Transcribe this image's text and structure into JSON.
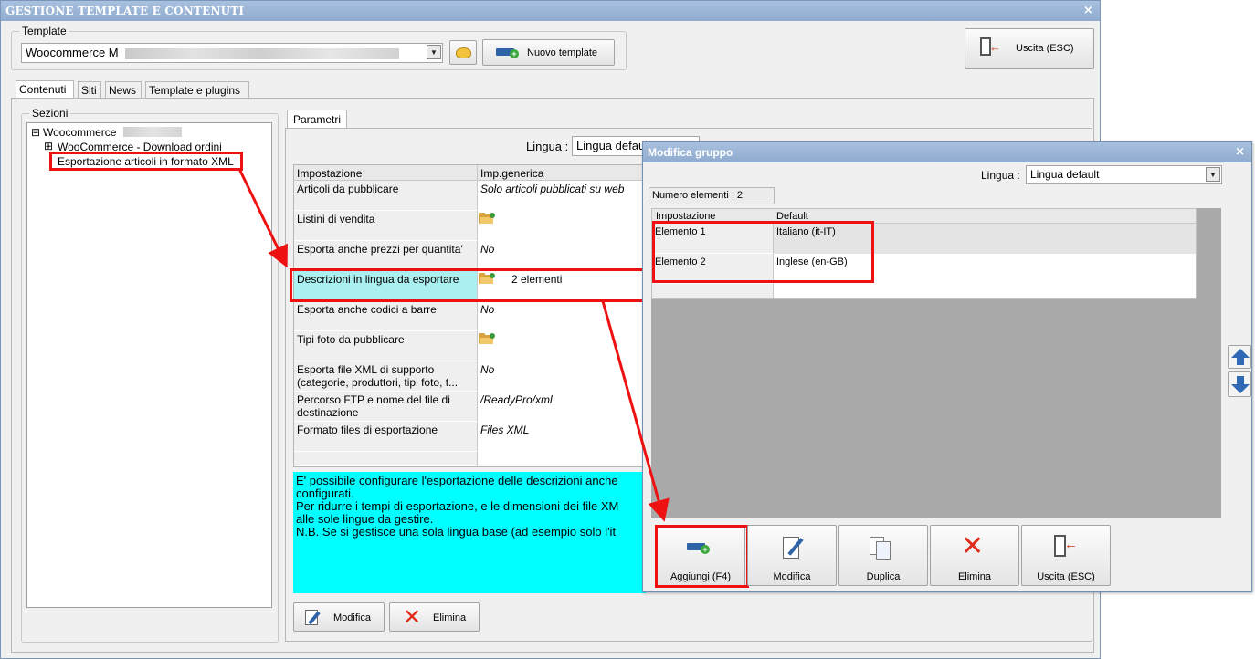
{
  "main_window": {
    "title": "GESTIONE TEMPLATE E CONTENUTI",
    "close_glyph": "×",
    "template_group": {
      "legend": "Template",
      "selected_template": "Woocommerce M",
      "new_template_label": "Nuovo template"
    },
    "exit_label": "Uscita (ESC)",
    "tabs": [
      "Contenuti",
      "Siti",
      "News",
      "Template e plugins"
    ],
    "sections": {
      "legend": "Sezioni",
      "tree": [
        {
          "expander": "⊟",
          "label": "Woocommerce "
        },
        {
          "expander": "⊞",
          "label": "WooCommerce - Download ordini"
        },
        {
          "expander": "",
          "label": "Esportazione articoli in formato XML"
        }
      ]
    },
    "params": {
      "tab_label": "Parametri",
      "lingua_label": "Lingua :",
      "lingua_value": "Lingua default",
      "columns": [
        "Impostazione",
        "Imp.generica"
      ],
      "rows": [
        {
          "name": "Articoli da pubblicare",
          "value": "Solo articoli pubblicati su web"
        },
        {
          "name": "Listini di vendita",
          "value": ""
        },
        {
          "name": "Esporta anche prezzi per quantita'",
          "value": "No"
        },
        {
          "name": "Descrizioni in lingua da esportare",
          "value": "2 elementi"
        },
        {
          "name": "Esporta anche codici a barre",
          "value": "No"
        },
        {
          "name": "Tipi foto da pubblicare",
          "value": ""
        },
        {
          "name": "Esporta file XML di supporto (categorie, produttori, tipi foto, t...",
          "value": "No"
        },
        {
          "name": "Percorso FTP e nome del file di destinazione",
          "value": "/ReadyPro/xml"
        },
        {
          "name": "Formato files di esportazione",
          "value": "Files XML"
        }
      ],
      "help_lines": [
        "E' possibile configurare l'esportazione delle descrizioni anche",
        "configurati.",
        "Per ridurre i tempi di esportazione, e le dimensioni dei file XM",
        "alle sole lingue da gestire.",
        "N.B. Se si gestisce una sola lingua base (ad esempio solo l'it"
      ],
      "modify_label": "Modifica",
      "delete_label": "Elimina"
    }
  },
  "popup": {
    "title": "Modifica gruppo",
    "close_glyph": "×",
    "lingua_label": "Lingua :",
    "lingua_value": "Lingua default",
    "count_label": "Numero elementi : 2",
    "columns": [
      "Impostazione",
      "Default"
    ],
    "rows": [
      {
        "name": "Elemento 1",
        "value": "Italiano (it-IT)"
      },
      {
        "name": "Elemento 2",
        "value": "Inglese (en-GB)"
      }
    ],
    "buttons": [
      "Aggiungi (F4)",
      "Modifica",
      "Duplica",
      "Elimina",
      "Uscita (ESC)"
    ]
  },
  "colors": {
    "titlebar": "#9bb5d8",
    "highlight_red": "#ee1111",
    "help_bg": "#00ffff",
    "selected_row": "#aaf0f0"
  }
}
